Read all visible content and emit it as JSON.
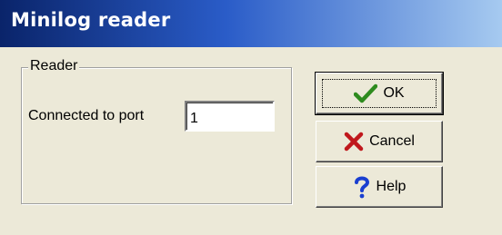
{
  "window": {
    "title": "Minilog reader"
  },
  "group": {
    "label": "Reader"
  },
  "port": {
    "label": "Connected to port",
    "value": "1"
  },
  "buttons": {
    "ok": {
      "label": "OK",
      "icon": "check-icon",
      "icon_color": "#2e8b1e"
    },
    "cancel": {
      "label": "Cancel",
      "icon": "cross-icon",
      "icon_color": "#c0181c"
    },
    "help": {
      "label": "Help",
      "icon": "question-icon",
      "icon_color": "#1a3fd0"
    }
  },
  "colors": {
    "title_gradient_start": "#0a246a",
    "title_gradient_end": "#a6caf0",
    "dialog_background": "#ece9d8"
  }
}
